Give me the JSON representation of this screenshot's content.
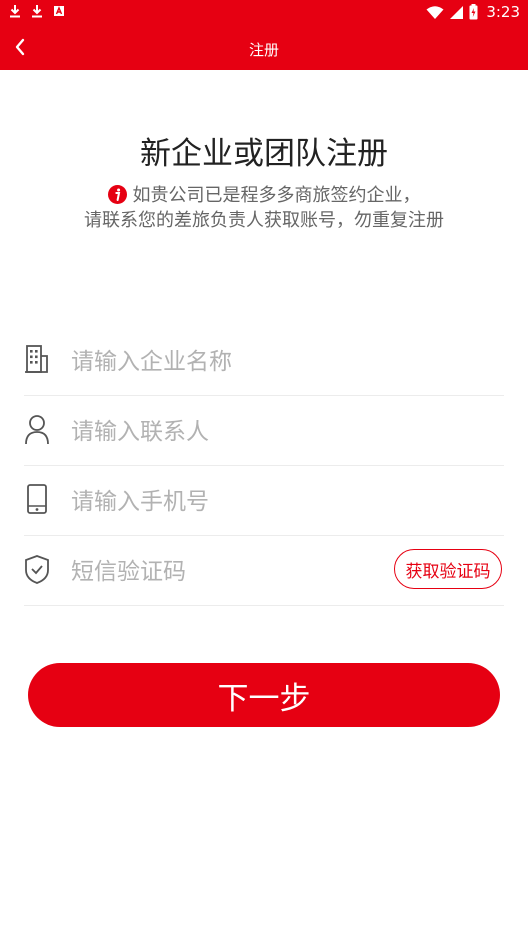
{
  "status_bar": {
    "time": "3:23"
  },
  "app_bar": {
    "title": "注册"
  },
  "heading": "新企业或团队注册",
  "notice": {
    "line1": "如贵公司已是程多多商旅签约企业，",
    "line2": "请联系您的差旅负责人获取账号，勿重复注册"
  },
  "form": {
    "company_placeholder": "请输入企业名称",
    "contact_placeholder": "请输入联系人",
    "phone_placeholder": "请输入手机号",
    "code_placeholder": "短信验证码",
    "get_code_label": "获取验证码"
  },
  "next_label": "下一步",
  "colors": {
    "brand": "#e60012",
    "placeholder": "#b2b2b2",
    "heading": "#222222",
    "notice": "#666666"
  }
}
